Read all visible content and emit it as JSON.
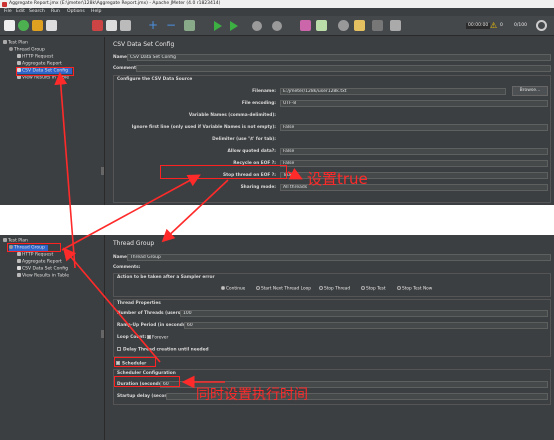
{
  "top": {
    "window_title": "Aggregate Report.jmx (E:\\jmeter\\128k\\Aggregate Report.jmx) - Apache JMeter (4.0 r1823414)",
    "menu": [
      "File",
      "Edit",
      "Search",
      "Run",
      "Options",
      "Help"
    ],
    "timer": "00:00:00",
    "warn_count": "0",
    "thread_ratio": "0/100",
    "tree": {
      "plan": "Test Plan",
      "group": "Thread Group",
      "http": "HTTP Request",
      "aggregate": "Aggregate Report",
      "csv": "CSV Data Set Config",
      "tree_view": "View Results in Table"
    },
    "panel": {
      "title": "CSV Data Set Config",
      "name_label": "Name:",
      "name_value": "CSV Data Set Config",
      "comments_label": "Comments:",
      "section_title": "Configure the CSV Data Source",
      "filename_label": "Filename:",
      "filename_value": "E:/jmeter/128k/user128k.txt",
      "browse_label": "Browse...",
      "encoding_label": "File encoding:",
      "encoding_value": "UTF-8",
      "varnames_label": "Variable Names (comma-delimited):",
      "ignore_label": "Ignore first line (only used if Variable Names is not empty):",
      "ignore_value": "False",
      "delimiter_label": "Delimiter (use '\\t' for tab):",
      "quoted_label": "Allow quoted data?:",
      "quoted_value": "False",
      "recycle_label": "Recycle on EOF ?:",
      "recycle_value": "False",
      "stop_label": "Stop thread on EOF ?:",
      "stop_value": "True",
      "sharing_label": "Sharing mode:",
      "sharing_value": "All threads"
    }
  },
  "bottom": {
    "tree": {
      "plan": "Test Plan",
      "group": "Thread Group",
      "http": "HTTP Request",
      "aggregate": "Aggregate Report",
      "csv": "CSV Data Set Config",
      "tree_view": "View Results in Table"
    },
    "panel": {
      "title": "Thread Group",
      "name_label": "Name:",
      "name_value": "Thread Group",
      "comments_label": "Comments:",
      "error_section": "Action to be taken after a Sampler error",
      "opt_continue": "Continue",
      "opt_next": "Start Next Thread Loop",
      "opt_stop_thread": "Stop Thread",
      "opt_stop_test": "Stop Test",
      "opt_stop_now": "Stop Test Now",
      "props_section": "Thread Properties",
      "threads_label": "Number of Threads (users):",
      "threads_value": "100",
      "rampup_label": "Ramp-Up Period (in seconds):",
      "rampup_value": "60",
      "loop_label": "Loop Count:",
      "loop_forever": "Forever",
      "delay_label": "Delay Thread creation until needed",
      "scheduler_label": "Scheduler",
      "sched_section": "Scheduler Configuration",
      "duration_label": "Duration (seconds)",
      "duration_value": "60",
      "startup_label": "Startup delay (seconds)"
    }
  },
  "annotations": {
    "set_true": "设置true",
    "set_time": "同时设置执行时间"
  },
  "colors": {
    "annotation": "#ff2a2a",
    "panel": "#3c3f41",
    "selection": "#2f65ca"
  }
}
